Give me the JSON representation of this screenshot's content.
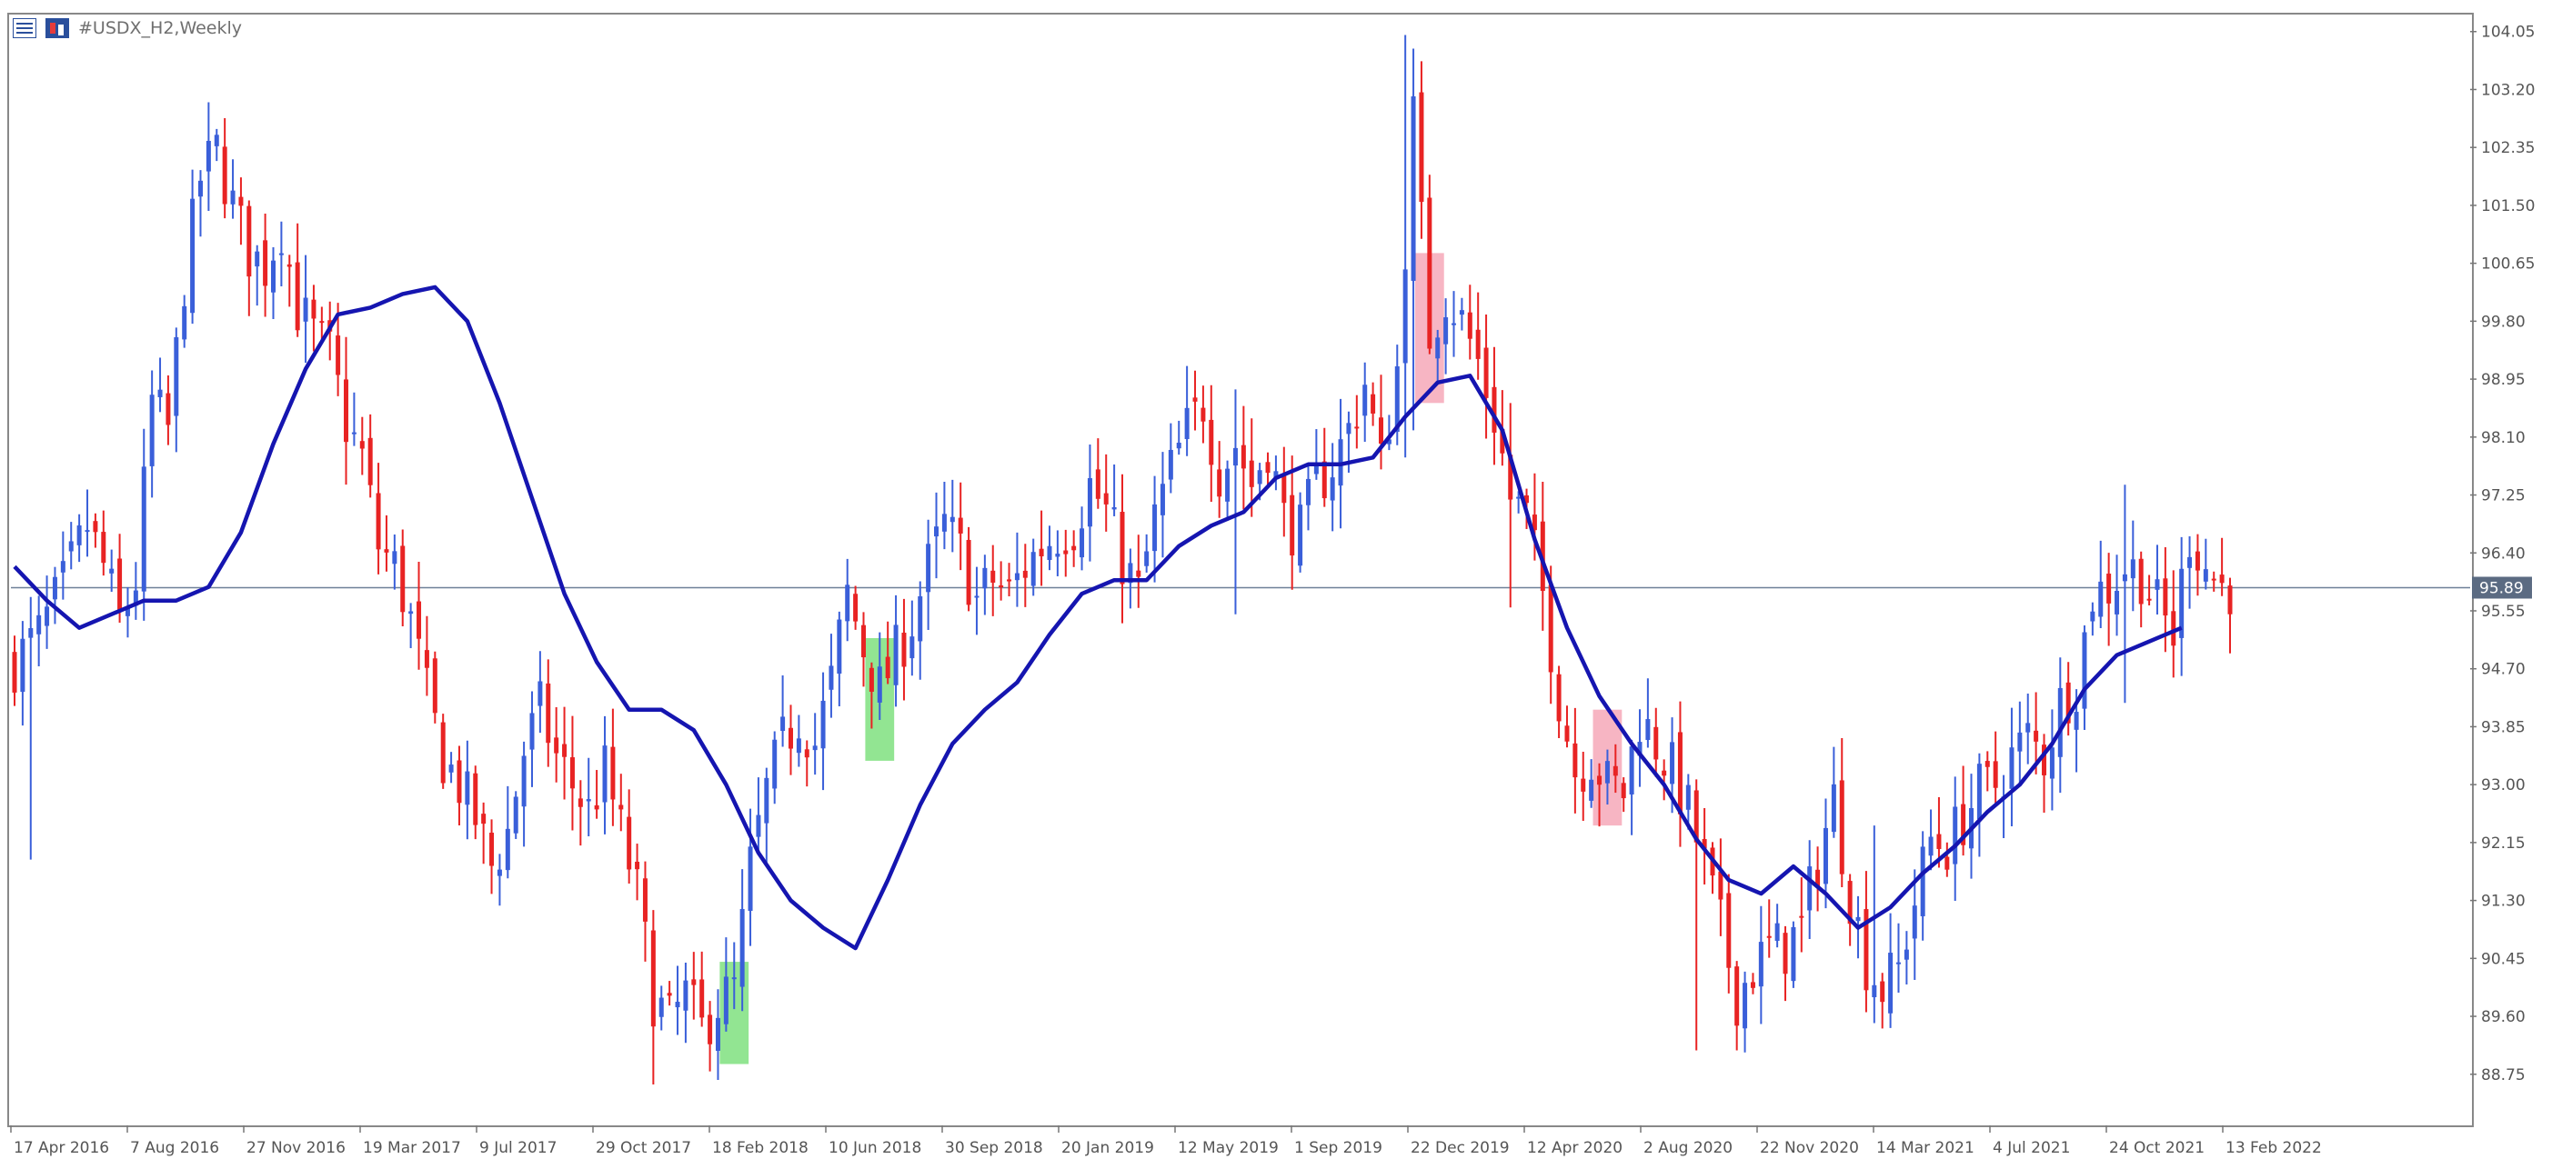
{
  "window": {
    "title": "#USDX_H2,Weekly"
  },
  "icons": {
    "left": "chart-list-icon",
    "right": "chart-toolbar-icon"
  },
  "colors": {
    "bull": "#3a5fd9",
    "bear": "#e82323",
    "ma": "#1515b0",
    "current_line": "#6e8098",
    "price_tag_bg": "#5b6b82",
    "highlight_green": "#7fe07f",
    "highlight_pink": "#f6a8b8"
  },
  "chart_data": {
    "type": "candlestick",
    "symbol": "#USDX_H2",
    "timeframe": "Weekly",
    "ylim": [
      88.0,
      104.3
    ],
    "y_ticks": [
      "104.05",
      "103.20",
      "102.35",
      "101.50",
      "100.65",
      "99.80",
      "98.95",
      "98.10",
      "97.25",
      "96.40",
      "95.55",
      "94.70",
      "93.85",
      "93.00",
      "92.15",
      "91.30",
      "90.45",
      "89.60",
      "88.75"
    ],
    "x_tick_labels": [
      "17 Apr 2016",
      "7 Aug 2016",
      "27 Nov 2016",
      "19 Mar 2017",
      "9 Jul 2017",
      "29 Oct 2017",
      "18 Feb 2018",
      "10 Jun 2018",
      "30 Sep 2018",
      "20 Jan 2019",
      "12 May 2019",
      "1 Sep 2019",
      "22 Dec 2019",
      "12 Apr 2020",
      "2 Aug 2020",
      "22 Nov 2020",
      "14 Mar 2021",
      "4 Jul 2021",
      "24 Oct 2021",
      "13 Feb 2022"
    ],
    "current_price": 95.89,
    "current_price_label": "95.89",
    "close_path": [
      [
        0,
        94.8
      ],
      [
        3,
        95.2
      ],
      [
        6,
        95.9
      ],
      [
        9,
        96.8
      ],
      [
        11,
        96.2
      ],
      [
        13,
        95.4
      ],
      [
        15,
        96.0
      ],
      [
        17,
        98.6
      ],
      [
        19,
        98.2
      ],
      [
        21,
        100.4
      ],
      [
        23,
        101.9
      ],
      [
        25,
        102.3
      ],
      [
        27,
        101.5
      ],
      [
        29,
        100.8
      ],
      [
        31,
        100.6
      ],
      [
        33,
        101.2
      ],
      [
        35,
        100.0
      ],
      [
        37,
        99.6
      ],
      [
        39,
        99.3
      ],
      [
        41,
        98.3
      ],
      [
        43,
        97.8
      ],
      [
        45,
        96.5
      ],
      [
        47,
        96.2
      ],
      [
        49,
        95.4
      ],
      [
        51,
        94.3
      ],
      [
        53,
        93.4
      ],
      [
        55,
        93.0
      ],
      [
        57,
        92.5
      ],
      [
        59,
        91.8
      ],
      [
        61,
        92.3
      ],
      [
        63,
        93.5
      ],
      [
        65,
        94.1
      ],
      [
        67,
        93.4
      ],
      [
        69,
        93.0
      ],
      [
        71,
        92.6
      ],
      [
        73,
        93.2
      ],
      [
        75,
        92.3
      ],
      [
        77,
        91.4
      ],
      [
        79,
        89.9
      ],
      [
        81,
        89.5
      ],
      [
        83,
        89.9
      ],
      [
        85,
        89.4
      ],
      [
        87,
        89.8
      ],
      [
        89,
        90.0
      ],
      [
        91,
        91.8
      ],
      [
        93,
        92.9
      ],
      [
        95,
        93.6
      ],
      [
        97,
        94.0
      ],
      [
        99,
        93.6
      ],
      [
        101,
        94.5
      ],
      [
        103,
        95.8
      ],
      [
        105,
        95.0
      ],
      [
        107,
        94.4
      ],
      [
        109,
        94.9
      ],
      [
        111,
        95.4
      ],
      [
        113,
        96.2
      ],
      [
        115,
        96.8
      ],
      [
        117,
        96.4
      ],
      [
        119,
        95.7
      ],
      [
        121,
        96.0
      ],
      [
        123,
        95.8
      ],
      [
        125,
        96.2
      ],
      [
        127,
        96.5
      ],
      [
        129,
        96.7
      ],
      [
        131,
        96.8
      ],
      [
        133,
        97.4
      ],
      [
        135,
        97.0
      ],
      [
        137,
        96.3
      ],
      [
        139,
        95.8
      ],
      [
        141,
        96.9
      ],
      [
        143,
        97.6
      ],
      [
        145,
        98.2
      ],
      [
        147,
        98.6
      ],
      [
        149,
        97.6
      ],
      [
        151,
        98.0
      ],
      [
        153,
        97.4
      ],
      [
        155,
        98.0
      ],
      [
        157,
        96.9
      ],
      [
        159,
        96.7
      ],
      [
        161,
        97.4
      ],
      [
        163,
        97.7
      ],
      [
        165,
        98.2
      ],
      [
        167,
        98.9
      ],
      [
        169,
        97.7
      ],
      [
        171,
        99.1
      ],
      [
        173,
        102.8
      ],
      [
        175,
        99.6
      ],
      [
        177,
        100.2
      ],
      [
        179,
        99.8
      ],
      [
        181,
        99.2
      ],
      [
        183,
        98.4
      ],
      [
        185,
        97.2
      ],
      [
        187,
        96.9
      ],
      [
        189,
        95.8
      ],
      [
        191,
        94.3
      ],
      [
        193,
        93.2
      ],
      [
        195,
        93.4
      ],
      [
        197,
        93.0
      ],
      [
        199,
        92.9
      ],
      [
        201,
        94.0
      ],
      [
        203,
        93.6
      ],
      [
        205,
        93.2
      ],
      [
        207,
        92.6
      ],
      [
        209,
        91.8
      ],
      [
        211,
        90.9
      ],
      [
        213,
        89.9
      ],
      [
        215,
        90.3
      ],
      [
        217,
        90.6
      ],
      [
        219,
        90.6
      ],
      [
        221,
        90.9
      ],
      [
        223,
        91.9
      ],
      [
        225,
        92.8
      ],
      [
        227,
        91.4
      ],
      [
        229,
        90.4
      ],
      [
        231,
        90.0
      ],
      [
        233,
        90.3
      ],
      [
        235,
        91.3
      ],
      [
        237,
        92.2
      ],
      [
        239,
        92.1
      ],
      [
        241,
        92.5
      ],
      [
        243,
        92.9
      ],
      [
        245,
        93.0
      ],
      [
        247,
        93.4
      ],
      [
        249,
        93.7
      ],
      [
        251,
        93.4
      ],
      [
        253,
        94.2
      ],
      [
        255,
        94.5
      ],
      [
        257,
        95.8
      ],
      [
        259,
        95.9
      ],
      [
        261,
        96.2
      ],
      [
        263,
        96.1
      ],
      [
        265,
        95.6
      ],
      [
        267,
        95.2
      ],
      [
        269,
        96.7
      ],
      [
        271,
        96.2
      ],
      [
        273,
        95.9
      ]
    ],
    "ma_path": [
      [
        0,
        96.2
      ],
      [
        4,
        95.7
      ],
      [
        8,
        95.3
      ],
      [
        12,
        95.5
      ],
      [
        16,
        95.7
      ],
      [
        20,
        95.7
      ],
      [
        24,
        95.9
      ],
      [
        28,
        96.7
      ],
      [
        32,
        98.0
      ],
      [
        36,
        99.1
      ],
      [
        40,
        99.9
      ],
      [
        44,
        100.0
      ],
      [
        48,
        100.2
      ],
      [
        52,
        100.3
      ],
      [
        56,
        99.8
      ],
      [
        60,
        98.6
      ],
      [
        64,
        97.2
      ],
      [
        68,
        95.8
      ],
      [
        72,
        94.8
      ],
      [
        76,
        94.1
      ],
      [
        80,
        94.1
      ],
      [
        84,
        93.8
      ],
      [
        88,
        93.0
      ],
      [
        92,
        92.0
      ],
      [
        96,
        91.3
      ],
      [
        100,
        90.9
      ],
      [
        104,
        90.6
      ],
      [
        108,
        91.6
      ],
      [
        112,
        92.7
      ],
      [
        116,
        93.6
      ],
      [
        120,
        94.1
      ],
      [
        124,
        94.5
      ],
      [
        128,
        95.2
      ],
      [
        132,
        95.8
      ],
      [
        136,
        96.0
      ],
      [
        140,
        96.0
      ],
      [
        144,
        96.5
      ],
      [
        148,
        96.8
      ],
      [
        152,
        97.0
      ],
      [
        156,
        97.5
      ],
      [
        160,
        97.7
      ],
      [
        164,
        97.7
      ],
      [
        168,
        97.8
      ],
      [
        172,
        98.4
      ],
      [
        176,
        98.9
      ],
      [
        180,
        99.0
      ],
      [
        184,
        98.2
      ],
      [
        188,
        96.6
      ],
      [
        192,
        95.3
      ],
      [
        196,
        94.3
      ],
      [
        200,
        93.6
      ],
      [
        204,
        93.0
      ],
      [
        208,
        92.2
      ],
      [
        212,
        91.6
      ],
      [
        216,
        91.4
      ],
      [
        220,
        91.8
      ],
      [
        224,
        91.4
      ],
      [
        228,
        90.9
      ],
      [
        232,
        91.2
      ],
      [
        236,
        91.7
      ],
      [
        240,
        92.1
      ],
      [
        244,
        92.6
      ],
      [
        248,
        93.0
      ],
      [
        252,
        93.6
      ],
      [
        256,
        94.4
      ],
      [
        260,
        94.9
      ],
      [
        264,
        95.1
      ],
      [
        268,
        95.3
      ]
    ],
    "spikes": [
      [
        2,
        91.9,
        95.2
      ],
      [
        79,
        88.6,
        90.2
      ],
      [
        151,
        95.5,
        98.8
      ],
      [
        172,
        97.8,
        104.0
      ],
      [
        173,
        98.2,
        103.8
      ],
      [
        185,
        95.6,
        98.6
      ],
      [
        208,
        89.1,
        92.6
      ],
      [
        230,
        89.5,
        92.4
      ],
      [
        261,
        94.2,
        97.4
      ]
    ],
    "ma_period": 20,
    "highlights": [
      {
        "i0": 88,
        "i1": 90,
        "low": 88.9,
        "high": 90.4,
        "color": "green"
      },
      {
        "i0": 106,
        "i1": 108,
        "low": 93.35,
        "high": 95.15,
        "color": "green"
      },
      {
        "i0": 174,
        "i1": 176,
        "low": 98.6,
        "high": 100.8,
        "color": "pink"
      },
      {
        "i0": 196,
        "i1": 198,
        "low": 92.4,
        "high": 94.1,
        "color": "pink"
      }
    ]
  }
}
